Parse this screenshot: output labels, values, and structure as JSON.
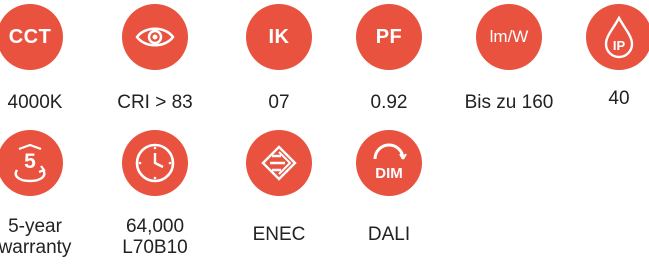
{
  "icons": [
    {
      "name": "cct",
      "code": "CCT",
      "icon": "cct-icon",
      "label": "4000K"
    },
    {
      "name": "cri",
      "icon": "eye-icon",
      "label": "CRI > 83"
    },
    {
      "name": "ik",
      "code": "IK",
      "icon": "ik-icon",
      "label": "07"
    },
    {
      "name": "pf",
      "code": "PF",
      "icon": "pf-icon",
      "label": "0.92"
    },
    {
      "name": "efficacy",
      "code": "lm/W",
      "icon": "lm-w-icon",
      "label": "Bis zu 160"
    },
    {
      "name": "ip",
      "code": "IP",
      "icon": "droplet-icon",
      "label": "40"
    },
    {
      "name": "warranty",
      "code": "5",
      "icon": "warranty-icon",
      "label_line1": "5-year",
      "label_line2": "warranty"
    },
    {
      "name": "lifetime",
      "icon": "clock-icon",
      "label_line1": "64,000",
      "label_line2": "L70B10"
    },
    {
      "name": "enec",
      "icon": "enec-icon",
      "label": "ENEC"
    },
    {
      "name": "dali",
      "code": "DIM",
      "icon": "dim-icon",
      "label": "DALI"
    }
  ],
  "colors": {
    "accent": "#e8523f",
    "text": "#222222"
  }
}
